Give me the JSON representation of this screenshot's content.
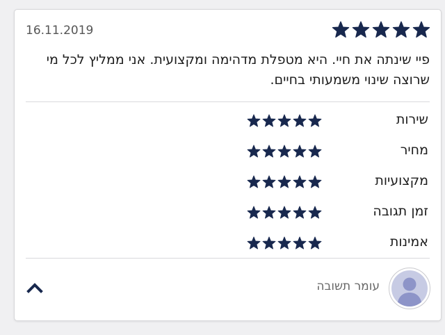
{
  "review": {
    "date": "16.11.2019",
    "overall_rating": 5,
    "overall_max": 5,
    "text": "פיי שינתה את חיי. היא מטפלת מדהימה ומקצועית. אני ממליץ לכל מי שרוצה שינוי משמעותי בחיים."
  },
  "ratings": [
    {
      "label": "שירות",
      "value": 5,
      "max": 5
    },
    {
      "label": "מחיר",
      "value": 5,
      "max": 5
    },
    {
      "label": "מקצועיות",
      "value": 5,
      "max": 5
    },
    {
      "label": "זמן תגובה",
      "value": 5,
      "max": 5
    },
    {
      "label": "אמינות",
      "value": 5,
      "max": 5
    }
  ],
  "footer": {
    "reply_label": "עומר תשובה",
    "avatar_icon": "user-avatar-icon",
    "collapse_icon": "chevron-up-icon"
  },
  "colors": {
    "star": "#18284e",
    "chevron": "#18284e",
    "avatar_bg": "#c7cbe4",
    "avatar_figure": "#8d94c8"
  }
}
